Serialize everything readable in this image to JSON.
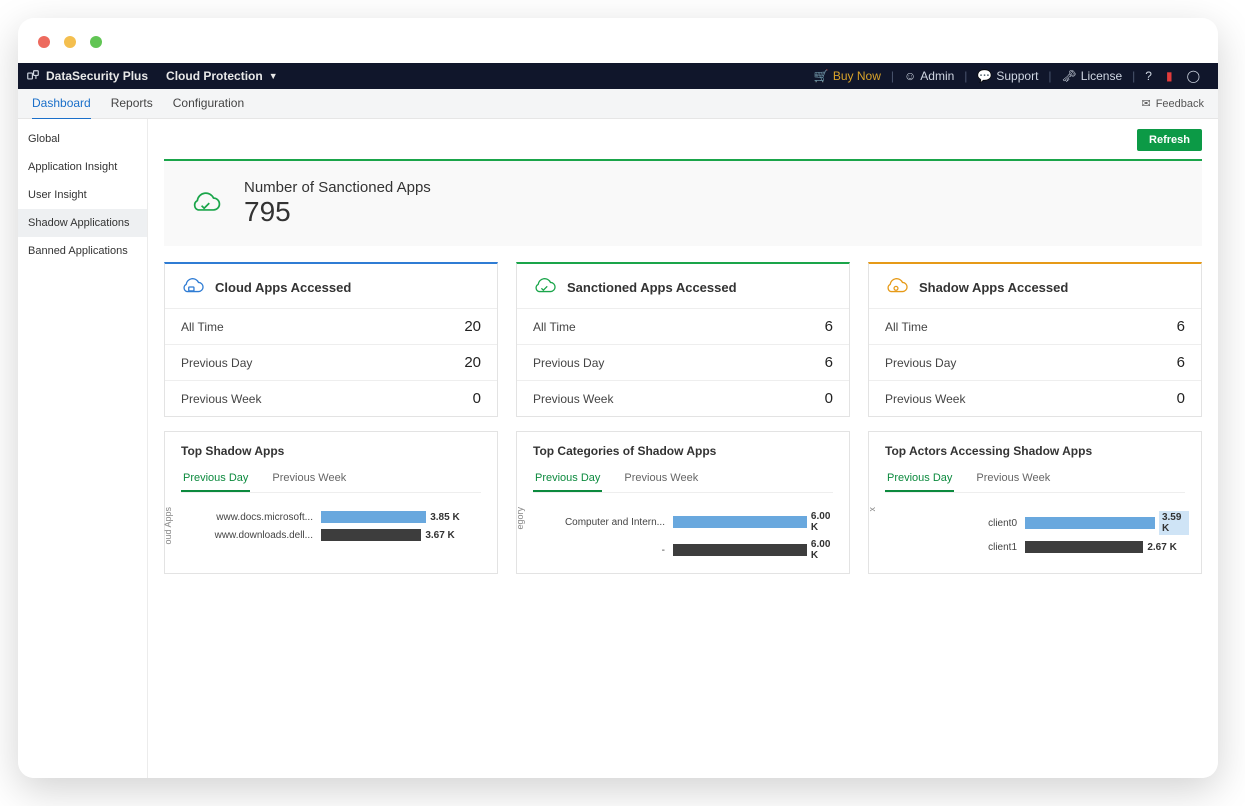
{
  "brand": "DataSecurity Plus",
  "module": "Cloud Protection",
  "topLinks": {
    "buy": "Buy Now",
    "admin": "Admin",
    "support": "Support",
    "license": "License"
  },
  "tabs": {
    "dashboard": "Dashboard",
    "reports": "Reports",
    "config": "Configuration"
  },
  "feedback": "Feedback",
  "sidebar": {
    "items": [
      {
        "label": "Global"
      },
      {
        "label": "Application Insight"
      },
      {
        "label": "User Insight"
      },
      {
        "label": "Shadow Applications",
        "active": true
      },
      {
        "label": "Banned Applications"
      }
    ]
  },
  "refresh": "Refresh",
  "headline": {
    "label": "Number of Sanctioned Apps",
    "value": "795"
  },
  "cards": [
    {
      "title": "Cloud Apps Accessed",
      "kind": "blue",
      "rows": [
        {
          "label": "All Time",
          "value": "20"
        },
        {
          "label": "Previous Day",
          "value": "20"
        },
        {
          "label": "Previous Week",
          "value": "0"
        }
      ]
    },
    {
      "title": "Sanctioned Apps Accessed",
      "kind": "green",
      "rows": [
        {
          "label": "All Time",
          "value": "6"
        },
        {
          "label": "Previous Day",
          "value": "6"
        },
        {
          "label": "Previous Week",
          "value": "0"
        }
      ]
    },
    {
      "title": "Shadow Apps Accessed",
      "kind": "orange",
      "rows": [
        {
          "label": "All Time",
          "value": "6"
        },
        {
          "label": "Previous Day",
          "value": "6"
        },
        {
          "label": "Previous Week",
          "value": "0"
        }
      ]
    }
  ],
  "miniTabs": {
    "prevDay": "Previous Day",
    "prevWeek": "Previous Week"
  },
  "charts": [
    {
      "title": "Top Shadow Apps",
      "axis": "oud Apps",
      "data": [
        {
          "name": "www.docs.microsoft...",
          "value": 3.85,
          "label": "3.85 K",
          "color": "blue"
        },
        {
          "name": "www.downloads.dell...",
          "value": 3.67,
          "label": "3.67 K",
          "color": "dark"
        }
      ],
      "max": 6.0
    },
    {
      "title": "Top Categories of Shadow Apps",
      "axis": "egory",
      "data": [
        {
          "name": "Computer and Intern...",
          "value": 6.0,
          "label": "6.00 K",
          "color": "blue"
        },
        {
          "name": "-",
          "value": 6.0,
          "label": "6.00 K",
          "color": "dark"
        }
      ],
      "max": 6.5
    },
    {
      "title": "Top Actors Accessing Shadow Apps",
      "axis": "x",
      "data": [
        {
          "name": "client0",
          "value": 3.59,
          "label": "3.59 K",
          "color": "blue",
          "highlight": true
        },
        {
          "name": "client1",
          "value": 2.67,
          "label": "2.67 K",
          "color": "dark"
        }
      ],
      "max": 3.7
    }
  ],
  "chart_data": [
    {
      "type": "bar",
      "title": "Top Shadow Apps",
      "ylabel": "oud Apps",
      "categories": [
        "www.docs.microsoft...",
        "www.downloads.dell..."
      ],
      "values": [
        3850,
        3670
      ],
      "value_labels": [
        "3.85 K",
        "3.67 K"
      ]
    },
    {
      "type": "bar",
      "title": "Top Categories of Shadow Apps",
      "ylabel": "egory",
      "categories": [
        "Computer and Intern...",
        "-"
      ],
      "values": [
        6000,
        6000
      ],
      "value_labels": [
        "6.00 K",
        "6.00 K"
      ]
    },
    {
      "type": "bar",
      "title": "Top Actors Accessing Shadow Apps",
      "ylabel": "x",
      "categories": [
        "client0",
        "client1"
      ],
      "values": [
        3590,
        2670
      ],
      "value_labels": [
        "3.59 K",
        "2.67 K"
      ]
    }
  ]
}
